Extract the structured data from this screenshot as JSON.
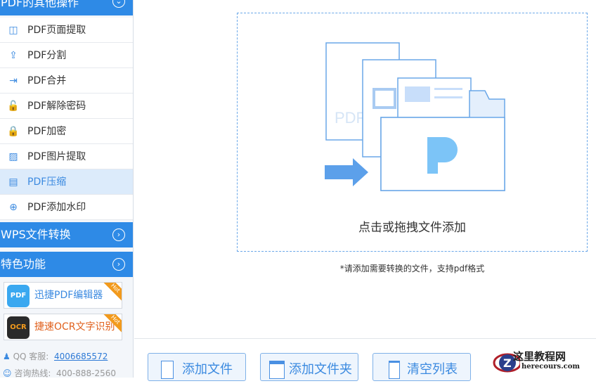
{
  "sidebar": {
    "section_other": "PDF的其他操作",
    "items": [
      {
        "label": "PDF页面提取",
        "icon": "page-extract-icon"
      },
      {
        "label": "PDF分割",
        "icon": "split-icon"
      },
      {
        "label": "PDF合并",
        "icon": "merge-icon"
      },
      {
        "label": "PDF解除密码",
        "icon": "unlock-icon"
      },
      {
        "label": "PDF加密",
        "icon": "lock-icon"
      },
      {
        "label": "PDF图片提取",
        "icon": "image-extract-icon"
      },
      {
        "label": "PDF压缩",
        "icon": "compress-icon"
      },
      {
        "label": "PDF添加水印",
        "icon": "watermark-icon"
      }
    ],
    "section_wps": "WPS文件转换",
    "section_feature": "特色功能",
    "promos": [
      {
        "label": "迅捷PDF编辑器",
        "logo": "PDF",
        "badge": "Hot"
      },
      {
        "label": "捷速OCR文字识别",
        "logo": "OCR",
        "badge": "Hot"
      }
    ],
    "qq_label": "QQ 客服:",
    "qq_number": "4006685572",
    "hotline_label": "咨询热线:",
    "hotline_number": "400-888-2560"
  },
  "main": {
    "drop_text": "点击或拖拽文件添加",
    "hint": "*请添加需要转换的文件，支持pdf格式",
    "buttons": {
      "add_file": "添加文件",
      "add_folder": "添加文件夹",
      "clear": "清空列表"
    }
  },
  "watermark": {
    "title": "这里教程网",
    "url": "herecours.com",
    "logo_letter": "Z"
  },
  "colors": {
    "accent": "#2e8ae6",
    "active_bg": "#dcebfb"
  }
}
